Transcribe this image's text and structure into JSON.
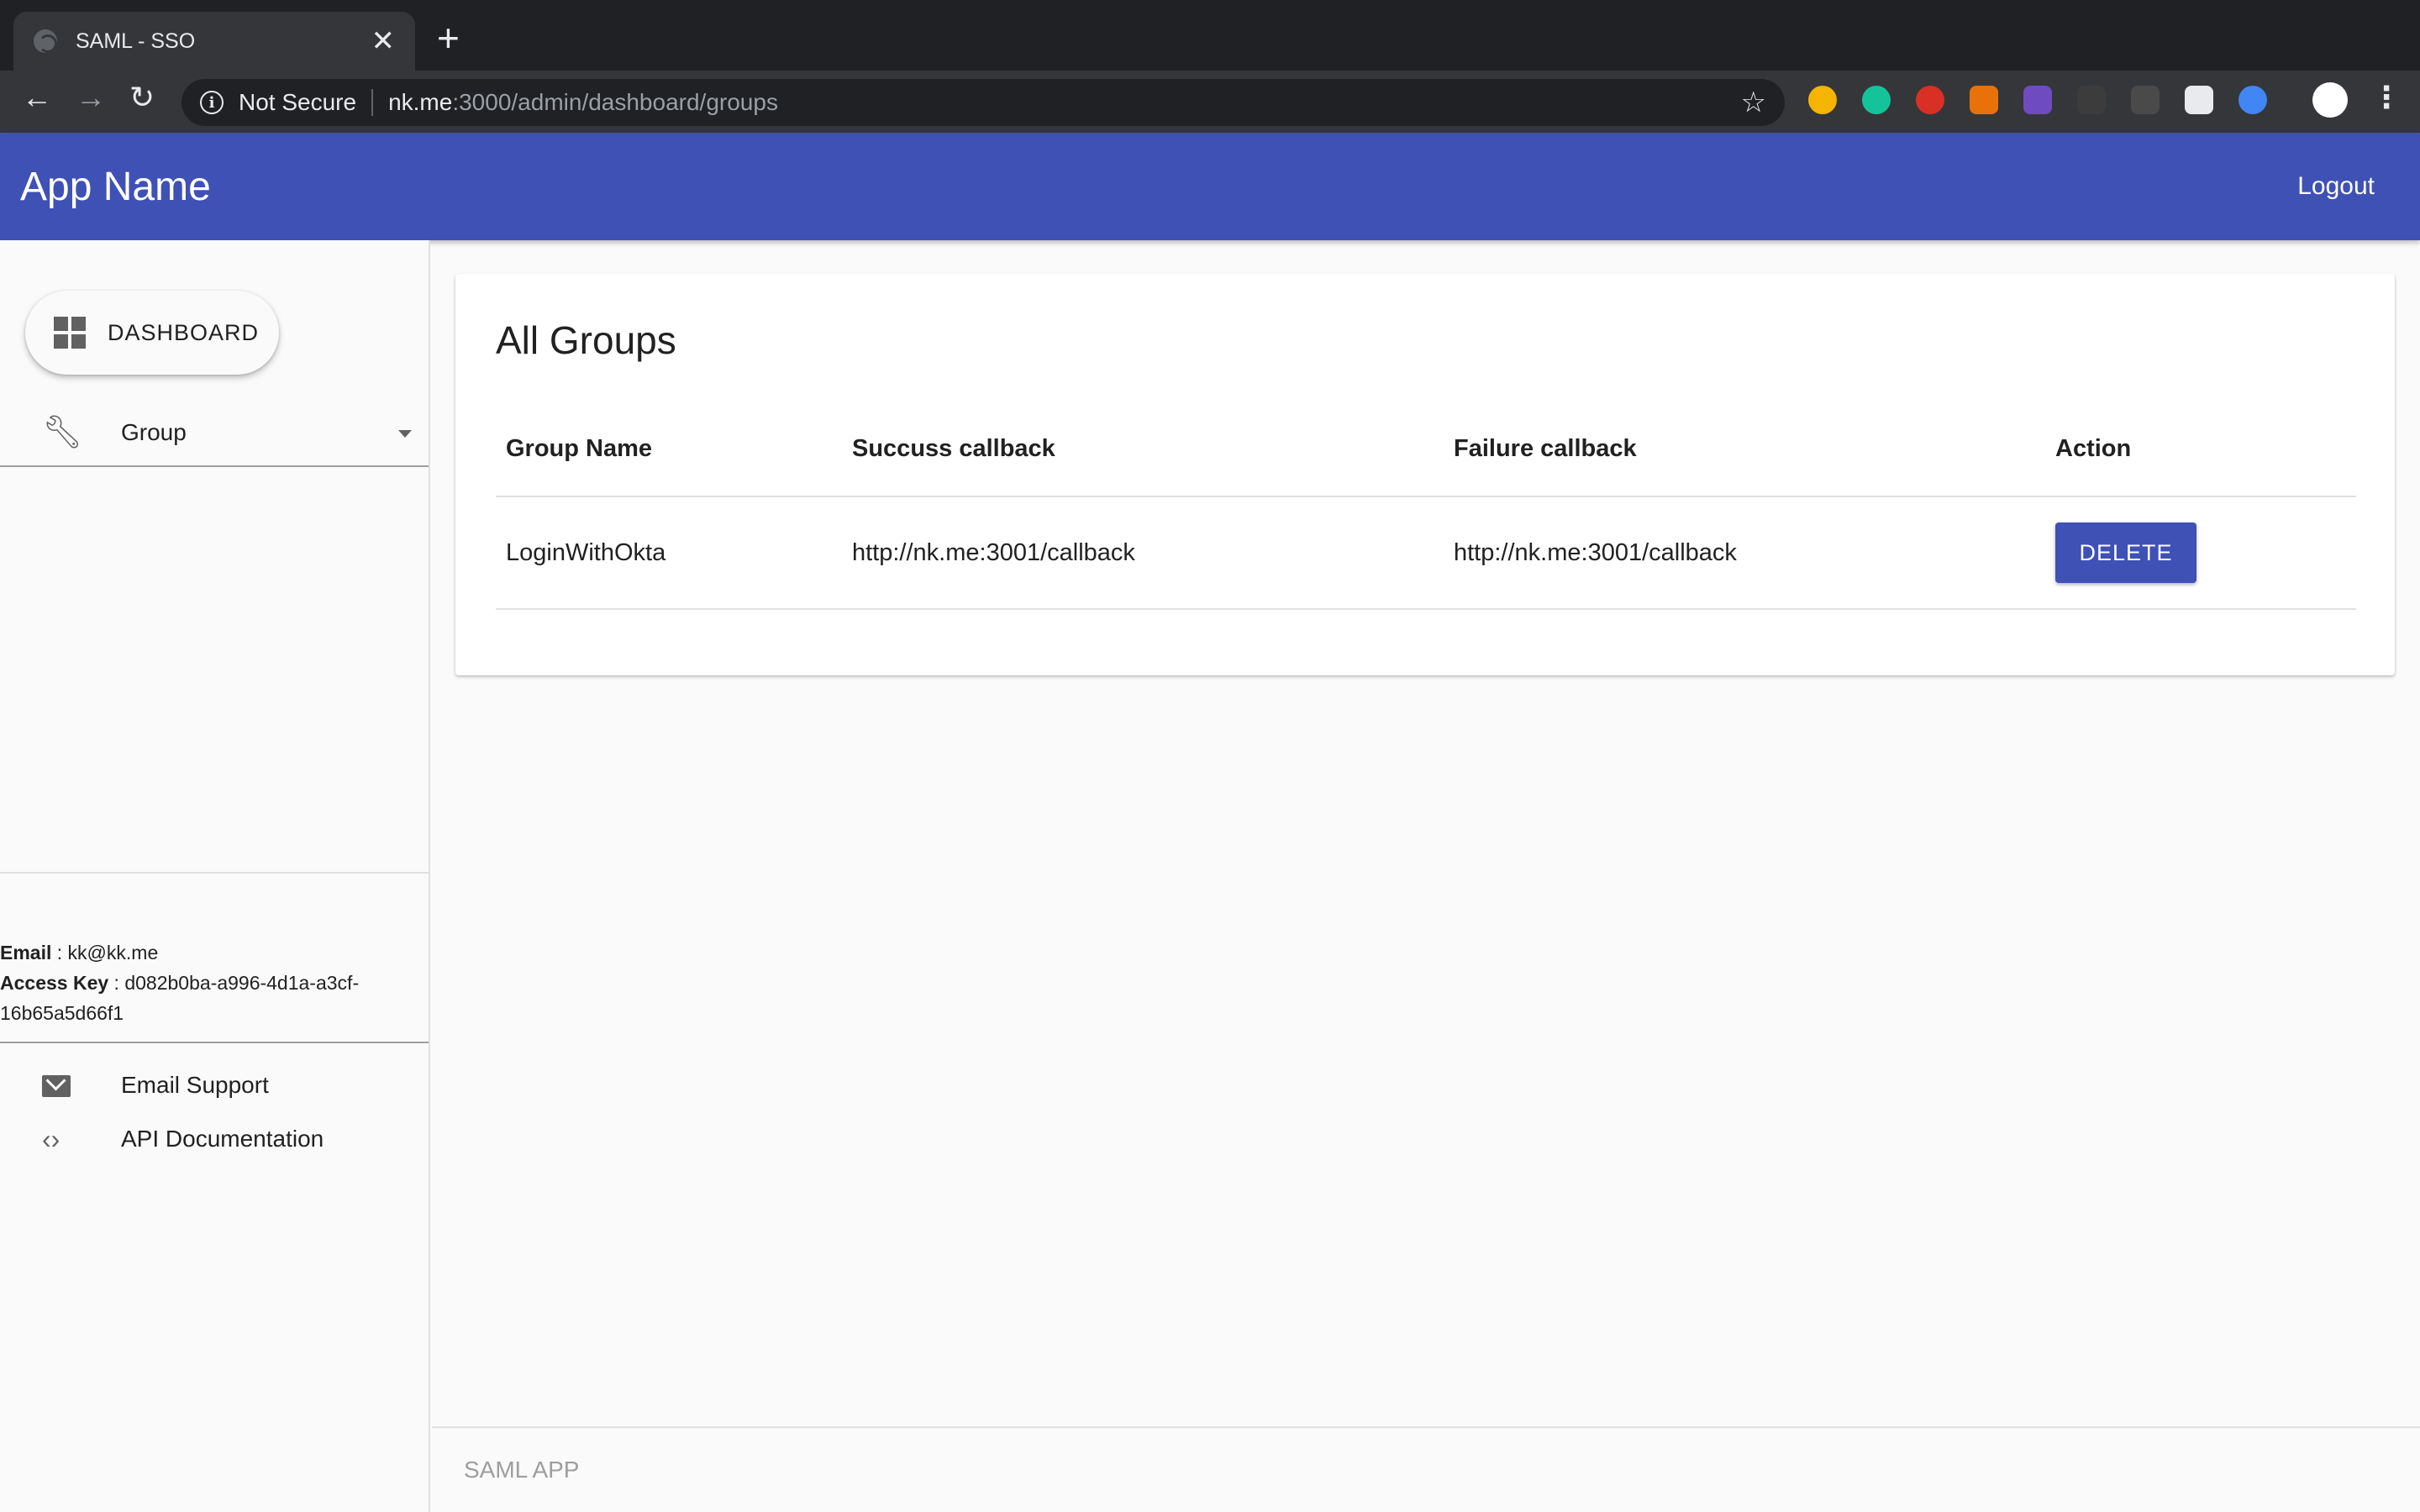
{
  "browser": {
    "tab_title": "SAML - SSO",
    "tab_close": "✕",
    "new_tab": "+",
    "back": "←",
    "forward": "→",
    "reload": "↻",
    "security_label": "Not Secure",
    "url_host": "nk.me",
    "url_path": ":3000/admin/dashboard/groups",
    "bookmark": "☆",
    "menu": "⋮",
    "extension_colors": [
      "#f4b400",
      "#15c39a",
      "#d93025",
      "#e8710a",
      "#6e4cbf",
      "#5f6368",
      "#9aa0a6",
      "#e8eaed",
      "#4285f4",
      "#ffffff"
    ]
  },
  "appbar": {
    "app_name": "App Name",
    "logout_label": "Logout"
  },
  "sidebar": {
    "dashboard_label": "DASHBOARD",
    "group_label": "Group",
    "email_label": "Email",
    "email_value": " : kk@kk.me",
    "access_key_label": "Access Key",
    "access_key_value": " : d082b0ba-a996-4d1a-a3cf-16b65a5d66f1",
    "links": [
      {
        "label": "Email Support",
        "icon": "mail-icon"
      },
      {
        "label": "API Documentation",
        "icon": "code-icon"
      }
    ]
  },
  "main": {
    "heading": "All Groups",
    "columns": [
      "Group Name",
      "Succuss callback",
      "Failure callback",
      "Action"
    ],
    "rows": [
      {
        "group_name": "LoginWithOkta",
        "success_callback": "http://nk.me:3001/callback",
        "failure_callback": "http://nk.me:3001/callback",
        "action_label": "DELETE"
      }
    ]
  },
  "footer": {
    "text": "SAML APP"
  },
  "colors": {
    "primary": "#3f51b5",
    "browser_dark": "#202124",
    "browser_toolbar": "#35363a"
  }
}
